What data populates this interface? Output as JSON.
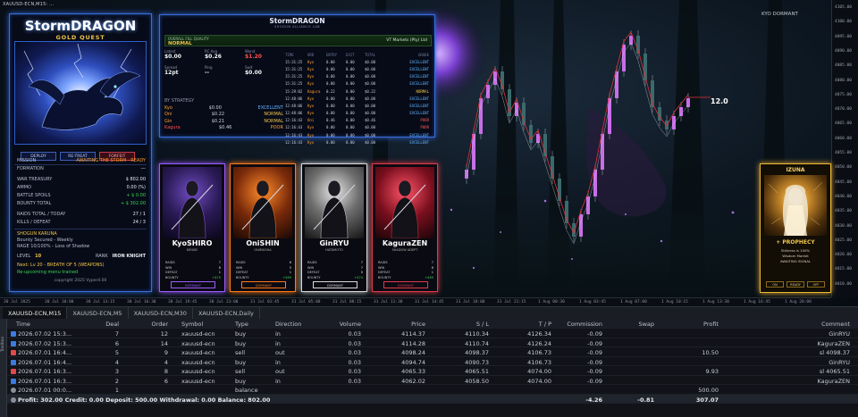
{
  "window": {
    "title": "XAUUSD-ECN,M15: ...",
    "symbol_label": "KYO DORMANT"
  },
  "chart": {
    "price_tag": "12.0",
    "price_axis": [
      "4105.00",
      "4100.00",
      "4095.00",
      "4090.00",
      "4085.00",
      "4080.00",
      "4075.00",
      "4070.00",
      "4065.00",
      "4060.00",
      "4055.00",
      "4050.00",
      "4045.00",
      "4040.00",
      "4035.00",
      "4030.00",
      "4025.00",
      "4020.00",
      "4015.00",
      "4010.00"
    ],
    "time_axis": [
      "30 Jul 2025",
      "30 Jul 10:00",
      "30 Jul 13:15",
      "30 Jul 16:30",
      "30 Jul 19:45",
      "30 Jul 23:00",
      "31 Jul 01:45",
      "31 Jul 05:00",
      "31 Jul 08:15",
      "31 Jul 11:30",
      "31 Jul 14:45",
      "31 Jul 18:00",
      "31 Jul 21:15",
      "1 Aug 00:30",
      "1 Aug 03:45",
      "1 Aug 07:00",
      "1 Aug 10:15",
      "1 Aug 13:30",
      "1 Aug 16:45",
      "1 Aug 20:00"
    ]
  },
  "left_panel": {
    "brand": "StormDRAGON",
    "subtitle": "GOLD QUEST",
    "buttons": [
      "DEPLOY",
      "RE-TREAT",
      "FORFEIT"
    ],
    "mission_label": "MISSION",
    "mission_value": "AWAITING THE STORM - READY",
    "formation_label": "FORMATION",
    "formation_value": "---",
    "rows": [
      {
        "label": "WAR TREASURY",
        "value": "$ 802.00"
      },
      {
        "label": "AMMO",
        "value": "0.00 (%)"
      },
      {
        "label": "BATTLE SPOILS",
        "value": "+ $ 0.00"
      },
      {
        "label": "BOUNTY TOTAL",
        "value": "+ $ 302.00"
      },
      {
        "label": "RAIDS TOTAL / TODAY",
        "value": "27 / 1"
      },
      {
        "label": "KILLS / DEFEAT",
        "value": "24 / 3"
      }
    ],
    "shogun_title": "SHOGUN KARUNA",
    "shogun_line1": "Bounty Secured - Weekly",
    "shogun_line2": "RAGE 10/100% - Loss of Shadow",
    "level_label": "LEVEL",
    "level_value": "10",
    "rank_label": "RANK",
    "rank_value": "IRON KNIGHT",
    "next_line": "Next: Lv 20 - BREATH OF 5 (WEAPONS)",
    "trained_line": "Re-upcoming menu trained",
    "copyright": "copyright 2025 Vyper4.00"
  },
  "stats_panel": {
    "title": "StormDRAGON",
    "subtitle": "SHOGUN ALLIANCE LAB",
    "quality_label": "OVERALL FILL QUALITY",
    "quality_value": "NORMAL",
    "quality_right": "VT Markets (Pty) Ltd",
    "cells": [
      {
        "label": "Latest",
        "value": "$0.00"
      },
      {
        "label": "RC Avg",
        "value": "$0.26"
      },
      {
        "label": "Worst",
        "value": "$1.20"
      },
      {
        "label": "Spread",
        "value": "12pt"
      },
      {
        "label": "Ping",
        "value": "--"
      },
      {
        "label": "Swit",
        "value": "$0.00"
      }
    ],
    "strategy_label": "BY STRATEGY",
    "strategies": [
      {
        "name": "Kyo",
        "value": "$0.00",
        "grade": "EXCELLENT"
      },
      {
        "name": "Oni",
        "value": "$0.22",
        "grade": "NORMAL"
      },
      {
        "name": "Gin",
        "value": "$0.21",
        "grade": "NORMAL"
      },
      {
        "name": "Kagura",
        "value": "$0.46",
        "grade": "POOR"
      }
    ],
    "table_headers": [
      "TIME",
      "ORD",
      "ENTRY",
      "EXIT",
      "TOTAL",
      "GRADE"
    ],
    "table_rows": [
      [
        "15:31:25",
        "Kyo",
        "0.00",
        "0.00",
        "$0.00",
        "EXCELLENT"
      ],
      [
        "15:31:25",
        "Kyo",
        "0.00",
        "0.00",
        "$0.00",
        "EXCELLENT"
      ],
      [
        "15:31:25",
        "Kyo",
        "0.00",
        "0.00",
        "$0.00",
        "EXCELLENT"
      ],
      [
        "15:31:25",
        "Kyo",
        "0.00",
        "0.00",
        "$0.00",
        "EXCELLENT"
      ],
      [
        "15:29:02",
        "Kagura",
        "0.22",
        "0.00",
        "$0.22",
        "NORMAL"
      ],
      [
        "12:48:06",
        "Kyo",
        "0.00",
        "0.00",
        "$0.00",
        "EXCELLENT"
      ],
      [
        "12:48:06",
        "Kyo",
        "0.00",
        "0.00",
        "$0.00",
        "EXCELLENT"
      ],
      [
        "12:48:06",
        "Kyo",
        "0.00",
        "0.00",
        "$0.00",
        "EXCELLENT"
      ],
      [
        "12:16:43",
        "Oni",
        "0.46",
        "0.00",
        "$0.46",
        "POOR"
      ],
      [
        "12:16:43",
        "Kyo",
        "0.00",
        "0.00",
        "$0.00",
        "POOR"
      ],
      [
        "12:16:43",
        "Kyo",
        "0.00",
        "0.00",
        "$0.00",
        "EXCELLENT"
      ],
      [
        "12:16:43",
        "Kyo",
        "0.00",
        "0.00",
        "$0.00",
        "EXCELLENT"
      ]
    ]
  },
  "cards": [
    {
      "name": "KyoSHIRO",
      "role": "KENSEI",
      "color": "#9a5cff",
      "footer": "DORMANT",
      "stats": [
        [
          "RAIDS",
          "7"
        ],
        [
          "WIN",
          "6"
        ],
        [
          "DEFEAT",
          "1"
        ],
        [
          "BOUNTY",
          "+$70"
        ]
      ]
    },
    {
      "name": "OniSHIN",
      "role": "ONIMUSHA",
      "color": "#ff7a1a",
      "footer": "DORMANT",
      "stats": [
        [
          "RAIDS",
          "6"
        ],
        [
          "WIN",
          "5"
        ],
        [
          "DEFEAT",
          "1"
        ],
        [
          "BOUNTY",
          "+$69"
        ]
      ]
    },
    {
      "name": "GinRYU",
      "role": "HATAMOTO",
      "color": "#d8d8d8",
      "footer": "DORMANT",
      "stats": [
        [
          "RAIDS",
          "7"
        ],
        [
          "WIN",
          "7"
        ],
        [
          "DEFEAT",
          "0"
        ],
        [
          "BOUNTY",
          "+$74"
        ]
      ]
    },
    {
      "name": "KaguraZEN",
      "role": "SHADOW ADEPT",
      "color": "#e13a4a",
      "footer": "DORMANT",
      "stats": [
        [
          "RAIDS",
          "7"
        ],
        [
          "WIN",
          "6"
        ],
        [
          "DEFEAT",
          "1"
        ],
        [
          "BOUNTY",
          "+$89"
        ]
      ]
    }
  ],
  "izuna": {
    "title": "IZUNA",
    "prophecy": "+ PROPHECY",
    "lines": [
      "Stillness is 100%",
      "Wisdom Market",
      "AWAITING SIGNAL"
    ],
    "buttons": [
      "ON",
      "READY",
      "OFF"
    ]
  },
  "tabs": [
    "XAUUSD-ECN,M15",
    "XAUUSD-ECN,M5",
    "XAUUSD-ECN,M30",
    "XAUUSD-ECN,Daily"
  ],
  "toolbox_label": "Toolbox",
  "history": {
    "headers": [
      "Time",
      "Deal",
      "Order",
      "Symbol",
      "Type",
      "Direction",
      "Volume",
      "Price",
      "S / L",
      "T / P",
      "Commission",
      "Swap",
      "Profit",
      "Comment"
    ],
    "rows": [
      {
        "icon": "buy",
        "time": "2026.07.02 15:3...",
        "deal": "7",
        "order": "12",
        "symbol": "xauusd-ecn",
        "type": "buy",
        "dir": "in",
        "vol": "0.03",
        "price": "4114.37",
        "sl": "4110.34",
        "tp": "4126.34",
        "comm": "-0.09",
        "swap": "",
        "profit": "",
        "comment": "GinRYU"
      },
      {
        "icon": "buy",
        "time": "2026.07.02 15:3...",
        "deal": "6",
        "order": "14",
        "symbol": "xauusd-ecn",
        "type": "buy",
        "dir": "in",
        "vol": "0.03",
        "price": "4114.28",
        "sl": "4110.74",
        "tp": "4126.24",
        "comm": "-0.09",
        "swap": "",
        "profit": "",
        "comment": "KaguraZEN"
      },
      {
        "icon": "sell",
        "time": "2026.07.01 16:4...",
        "deal": "5",
        "order": "9",
        "symbol": "xauusd-ecn",
        "type": "sell",
        "dir": "out",
        "vol": "0.03",
        "price": "4098.24",
        "sl": "4098.37",
        "tp": "4106.73",
        "comm": "-0.09",
        "swap": "",
        "profit": "10.50",
        "comment": "sl 4098.37"
      },
      {
        "icon": "buy",
        "time": "2026.07.01 16:4...",
        "deal": "4",
        "order": "4",
        "symbol": "xauusd-ecn",
        "type": "buy",
        "dir": "in",
        "vol": "0.03",
        "price": "4094.74",
        "sl": "4090.73",
        "tp": "4106.73",
        "comm": "-0.09",
        "swap": "",
        "profit": "",
        "comment": "GinRYU"
      },
      {
        "icon": "sell",
        "time": "2026.07.01 16:3...",
        "deal": "3",
        "order": "8",
        "symbol": "xauusd-ecn",
        "type": "sell",
        "dir": "out",
        "vol": "0.03",
        "price": "4065.33",
        "sl": "4065.51",
        "tp": "4074.00",
        "comm": "-0.09",
        "swap": "",
        "profit": "9.93",
        "comment": "sl 4065.51"
      },
      {
        "icon": "buy",
        "time": "2026.07.01 16:3...",
        "deal": "2",
        "order": "6",
        "symbol": "xauusd-ecn",
        "type": "buy",
        "dir": "in",
        "vol": "0.03",
        "price": "4062.02",
        "sl": "4058.50",
        "tp": "4074.00",
        "comm": "-0.09",
        "swap": "",
        "profit": "",
        "comment": "KaguraZEN"
      },
      {
        "icon": "bal",
        "time": "2026.07.01 00:0...",
        "deal": "1",
        "order": "",
        "symbol": "",
        "type": "balance",
        "dir": "",
        "vol": "",
        "price": "",
        "sl": "",
        "tp": "",
        "comm": "",
        "swap": "",
        "profit": "500.00",
        "comment": ""
      }
    ],
    "summary": {
      "text": "Profit: 302.00  Credit: 0.00  Deposit: 500.00  Withdrawal: 0.00  Balance: 802.00",
      "comm": "-4.26",
      "swap": "-0.81",
      "profit": "307.07"
    }
  }
}
